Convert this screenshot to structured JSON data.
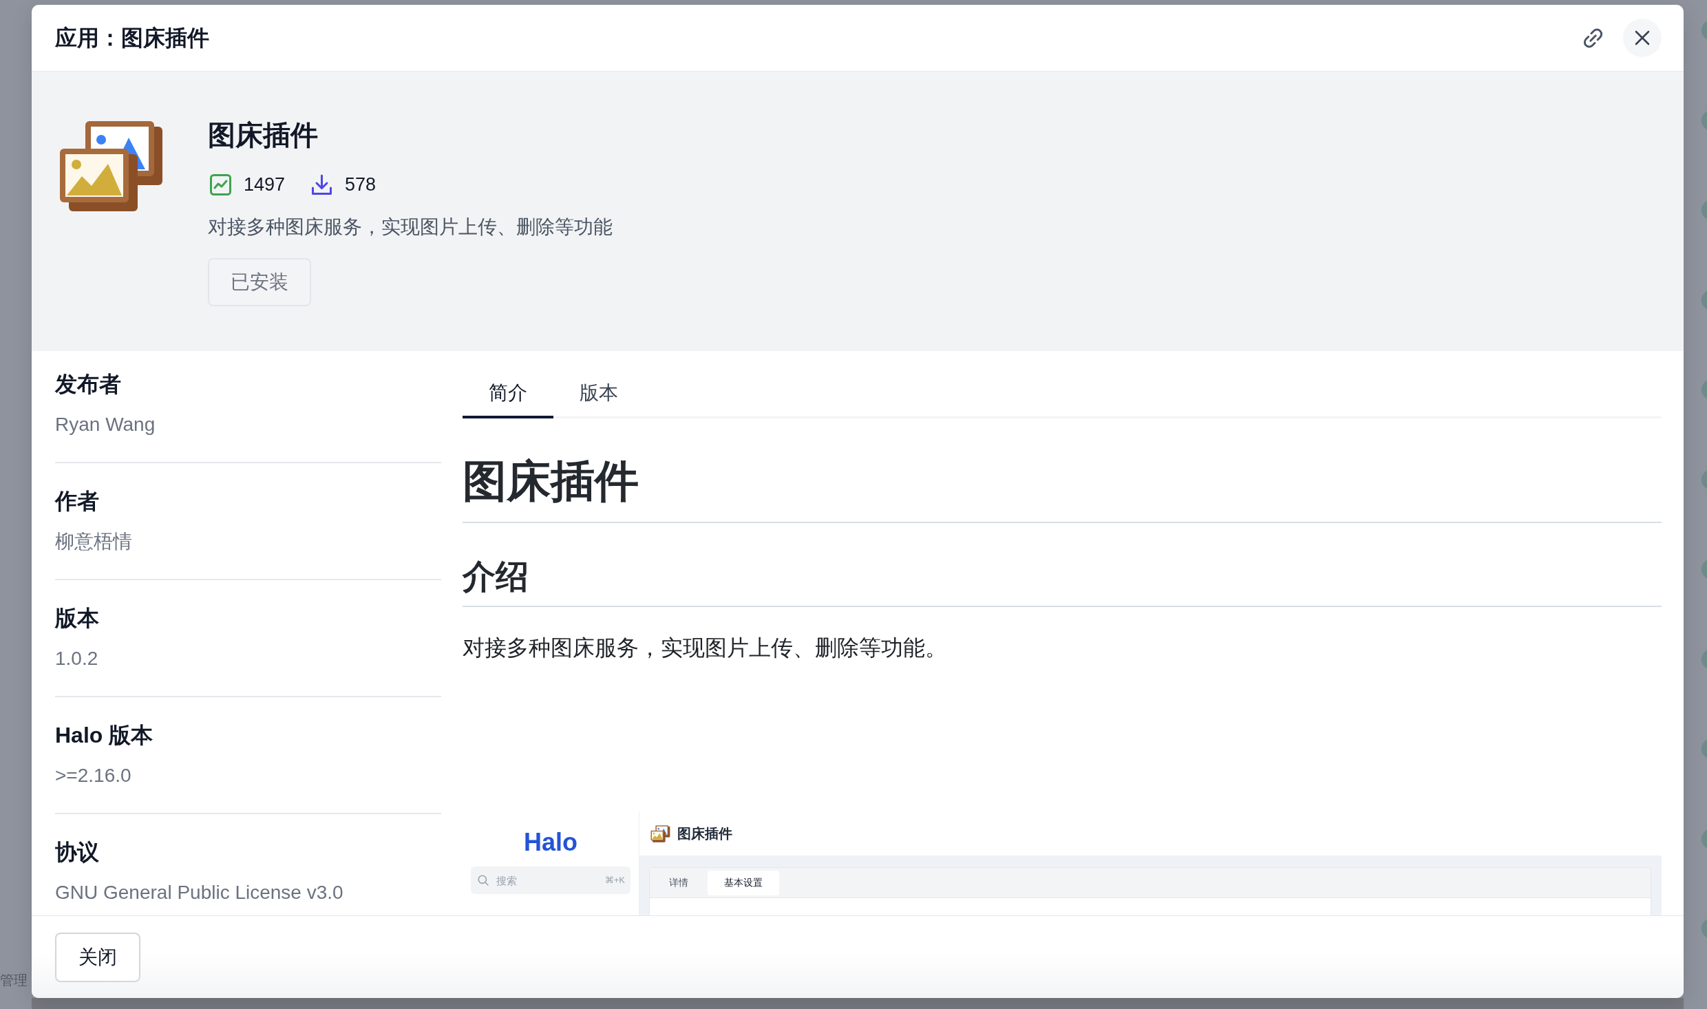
{
  "background": {
    "sidebar_text": "管理"
  },
  "dialog": {
    "title": "应用：图床插件"
  },
  "plugin": {
    "name": "图床插件",
    "views": "1497",
    "downloads": "578",
    "description": "对接多种图床服务，实现图片上传、删除等功能",
    "install_button": {
      "label": "已安装",
      "disabled": true
    }
  },
  "details": [
    {
      "label": "发布者",
      "value": "Ryan Wang"
    },
    {
      "label": "作者",
      "value": "柳意梧情"
    },
    {
      "label": "版本",
      "value": "1.0.2"
    },
    {
      "label": "Halo 版本",
      "value": ">=2.16.0"
    },
    {
      "label": "协议",
      "value": "GNU General Public License v3.0"
    }
  ],
  "tabs": [
    {
      "label": "简介",
      "selected": true
    },
    {
      "label": "版本",
      "selected": false
    }
  ],
  "readme": {
    "title": "图床插件",
    "heading": "介绍",
    "paragraph": "对接多种图床服务，实现图片上传、删除等功能。",
    "screenshot": {
      "logo": "Halo",
      "search": {
        "placeholder": "搜索",
        "shortcut": "⌘+K"
      },
      "page_title": "图床插件",
      "tabs": [
        {
          "label": "详情",
          "selected": false
        },
        {
          "label": "基本设置",
          "selected": true
        }
      ]
    }
  },
  "footer": {
    "close_button": "关闭"
  }
}
